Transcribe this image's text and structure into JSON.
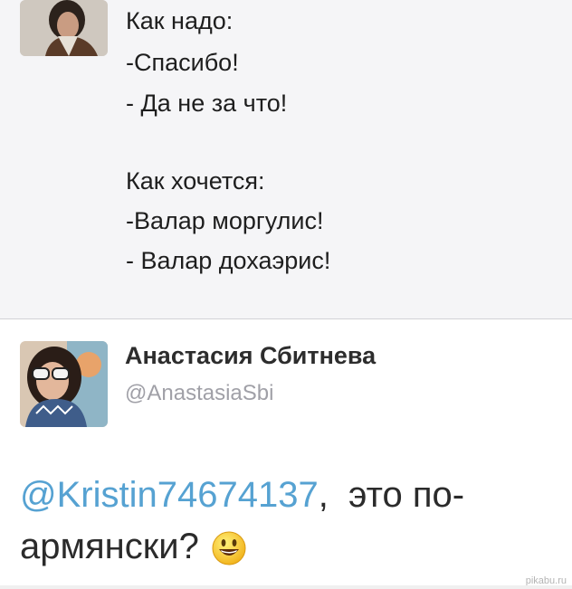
{
  "first_tweet": {
    "lines": [
      "Как надо:",
      "-Спасибо!",
      "- Да не за что!",
      "Как хочется:",
      "-Валар моргулис!",
      "- Валар дохаэрис!"
    ]
  },
  "second_tweet": {
    "user_name": "Анастасия Сбитнева",
    "user_handle": "@AnastasiaSbi",
    "mention": "@Kristin74674137",
    "text_line1_rest": ",  это по-",
    "text_line2": "армянски?",
    "emoji": "smiley-emoji"
  },
  "watermark": "pikabu.ru",
  "colors": {
    "mention": "#56a2d2",
    "top_background": "#f5f5f7",
    "handle": "#a0a0a7"
  }
}
